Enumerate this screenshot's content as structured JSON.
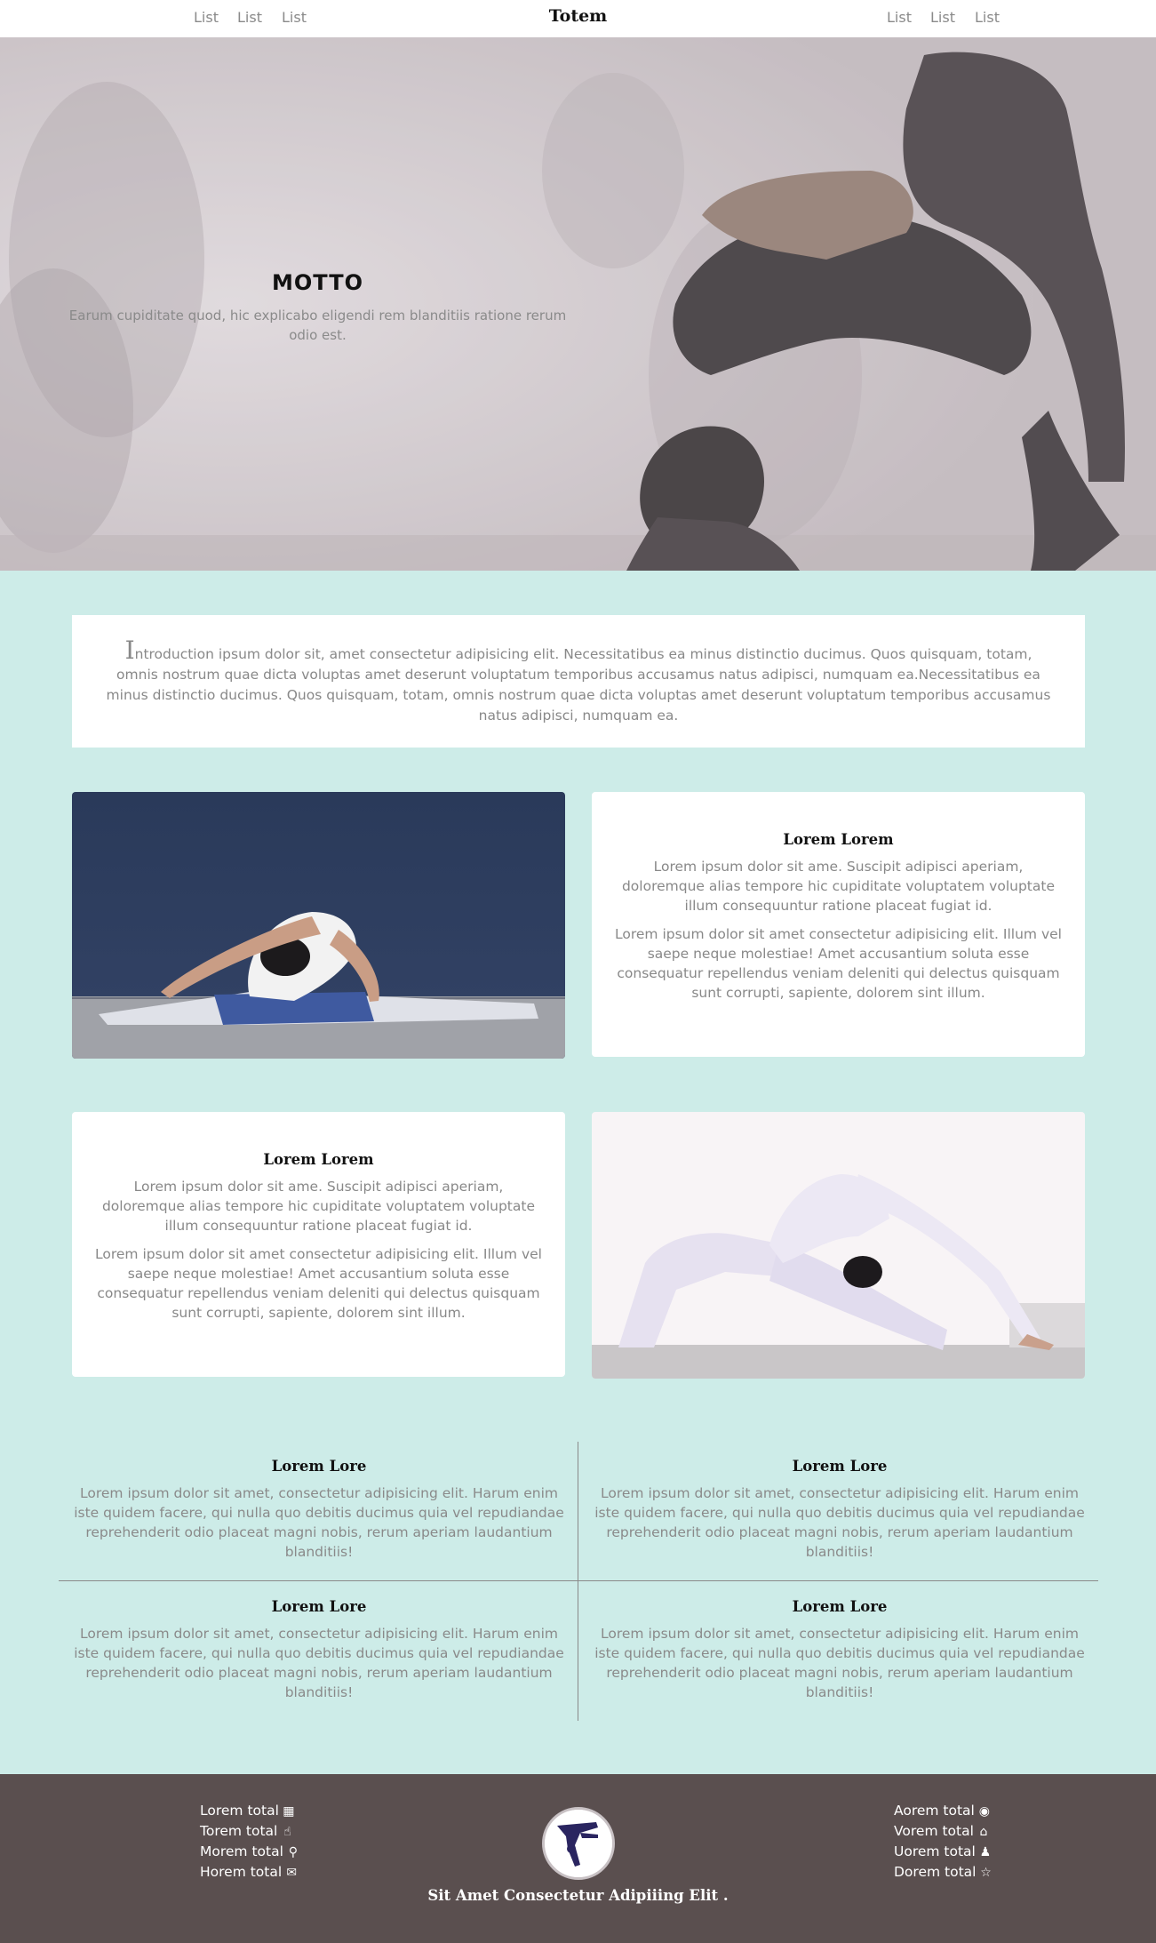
{
  "nav": {
    "brand": "Totem",
    "left_links": [
      "List",
      "List",
      "List"
    ],
    "right_links": [
      "List",
      "List",
      "List"
    ]
  },
  "hero": {
    "title": "MOTTO",
    "subtitle": "Earum cupiditate quod, hic explicabo eligendi rem blanditiis ratione rerum odio est."
  },
  "intro": {
    "dropcap": "I",
    "text": "ntroduction ipsum dolor sit, amet consectetur adipisicing elit. Necessitatibus ea minus distinctio ducimus. Quos quisquam, totam, omnis nostrum quae dicta voluptas amet deserunt voluptatum temporibus accusamus natus adipisci, numquam ea.Necessitatibus ea minus distinctio ducimus. Quos quisquam, totam, omnis nostrum quae dicta voluptas amet deserunt voluptatum temporibus accusamus natus adipisci, numquam ea."
  },
  "features": [
    {
      "title": "Lorem Lorem",
      "p1": "Lorem ipsum dolor sit ame. Suscipit adipisci aperiam, doloremque alias tempore hic cupiditate voluptatem voluptate illum consequuntur ratione placeat fugiat id.",
      "p2": "Lorem ipsum dolor sit amet consectetur adipisicing elit. Illum vel saepe neque molestiae! Amet accusantium soluta esse consequatur repellendus veniam deleniti qui delectus quisquam sunt corrupti, sapiente, dolorem sint illum."
    },
    {
      "title": "Lorem Lorem",
      "p1": "Lorem ipsum dolor sit ame. Suscipit adipisci aperiam, doloremque alias tempore hic cupiditate voluptatem voluptate illum consequuntur ratione placeat fugiat id.",
      "p2": "Lorem ipsum dolor sit amet consectetur adipisicing elit. Illum vel saepe neque molestiae! Amet accusantium soluta esse consequatur repellendus veniam deleniti qui delectus quisquam sunt corrupti, sapiente, dolorem sint illum."
    }
  ],
  "grid": [
    {
      "title": "Lorem Lore",
      "text": "Lorem ipsum dolor sit amet, consectetur adipisicing elit. Harum enim iste quidem facere, qui nulla quo debitis ducimus quia vel repudiandae reprehenderit odio placeat magni nobis, rerum aperiam laudantium blanditiis!"
    },
    {
      "title": "Lorem Lore",
      "text": "Lorem ipsum dolor sit amet, consectetur adipisicing elit. Harum enim iste quidem facere, qui nulla quo debitis ducimus quia vel repudiandae reprehenderit odio placeat magni nobis, rerum aperiam laudantium blanditiis!"
    },
    {
      "title": "Lorem Lore",
      "text": "Lorem ipsum dolor sit amet, consectetur adipisicing elit. Harum enim iste quidem facere, qui nulla quo debitis ducimus quia vel repudiandae reprehenderit odio placeat magni nobis, rerum aperiam laudantium blanditiis!"
    },
    {
      "title": "Lorem Lore",
      "text": "Lorem ipsum dolor sit amet, consectetur adipisicing elit. Harum enim iste quidem facere, qui nulla quo debitis ducimus quia vel repudiandae reprehenderit odio placeat magni nobis, rerum aperiam laudantium blanditiis!"
    }
  ],
  "footer": {
    "left": [
      {
        "label": "Lorem total",
        "icon": "calendar-icon"
      },
      {
        "label": "Torem total",
        "icon": "thumbs-up-icon"
      },
      {
        "label": "Morem total",
        "icon": "search-icon"
      },
      {
        "label": "Horem total",
        "icon": "envelope-icon"
      }
    ],
    "right": [
      {
        "label": "Aorem total",
        "icon": "camera-icon"
      },
      {
        "label": "Vorem total",
        "icon": "home-icon"
      },
      {
        "label": "Uorem total",
        "icon": "user-icon"
      },
      {
        "label": "Dorem total",
        "icon": "star-icon"
      }
    ],
    "tagline": "Sit Amet Consectetur Adipiiing Elit ."
  },
  "colors": {
    "background": "#cdece8",
    "footer": "#5a4f4f",
    "card": "#ffffff",
    "muted_text": "#8a8a8a"
  }
}
